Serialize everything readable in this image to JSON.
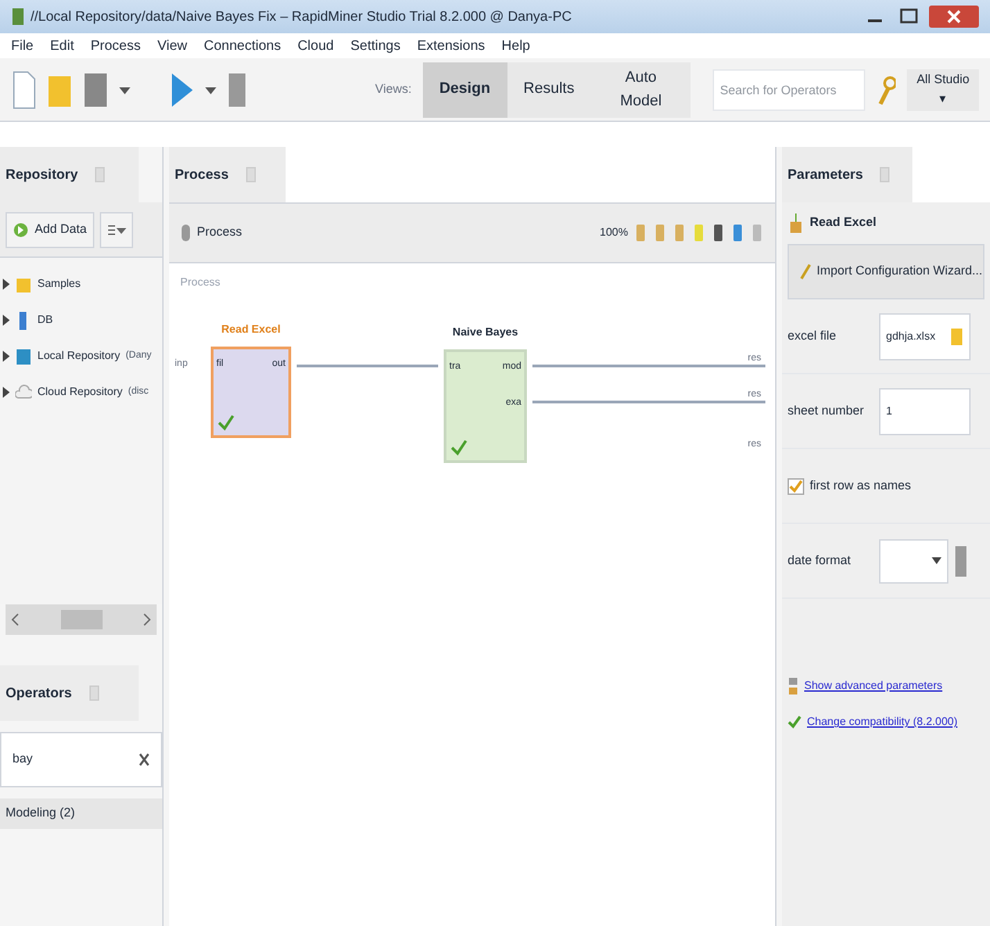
{
  "window": {
    "title": "//Local Repository/data/Naive Bayes Fix – RapidMiner Studio Trial 8.2.000 @ Danya-PC"
  },
  "menu": [
    "File",
    "Edit",
    "Process",
    "View",
    "Connections",
    "Cloud",
    "Settings",
    "Extensions",
    "Help"
  ],
  "toolbar": {
    "views_label": "Views:",
    "views": [
      {
        "label": "Design",
        "selected": true
      },
      {
        "label": "Results",
        "selected": false
      },
      {
        "label": "Auto Model",
        "selected": false
      }
    ],
    "search": {
      "placeholder": "Search for Operators"
    },
    "scope": "All Studio ▾"
  },
  "repository": {
    "tab": "Repository",
    "add_data": "Add Data",
    "items": [
      {
        "kind": "folder",
        "label": "Samples"
      },
      {
        "kind": "db",
        "label": "DB"
      },
      {
        "kind": "local",
        "label": "Local Repository",
        "note": "(Dany"
      },
      {
        "kind": "cloud",
        "label": "Cloud Repository",
        "note": "(disc"
      }
    ]
  },
  "operators_panel": {
    "tab": "Operators",
    "search": "bay",
    "result": "Modeling (2)"
  },
  "process": {
    "tab": "Process",
    "breadcrumb": "Process",
    "zoom": "100%",
    "canvas_label": "Process",
    "input_port": "inp",
    "operators": [
      {
        "name": "Read Excel",
        "selected": true,
        "color": "#dcd9ee",
        "inputs": [
          "fil"
        ],
        "outputs": [
          "out"
        ]
      },
      {
        "name": "Naive Bayes",
        "selected": false,
        "color": "#dbeccf",
        "inputs": [
          "tra"
        ],
        "outputs": [
          "mod",
          "exa"
        ]
      }
    ],
    "result_ports": [
      "res",
      "res",
      "res"
    ]
  },
  "parameters": {
    "tab": "Parameters",
    "operator": "Read Excel",
    "wizard": "Import Configuration Wizard...",
    "rows": [
      {
        "kind": "file",
        "label": "excel file",
        "value": "gdhja.xlsx"
      },
      {
        "kind": "text",
        "label": "sheet number",
        "value": "1"
      },
      {
        "kind": "checkbox",
        "label": "first row as names",
        "checked": true
      },
      {
        "kind": "select",
        "label": "date format",
        "value": ""
      }
    ],
    "links": [
      "Show advanced parameters",
      "Change compatibility (8.2.000)"
    ]
  }
}
